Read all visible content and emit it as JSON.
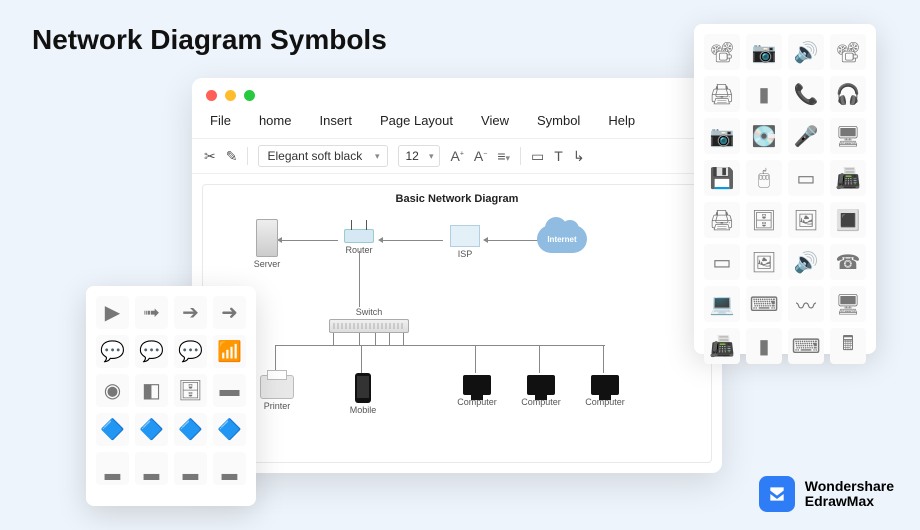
{
  "page_title": "Network Diagram Symbols",
  "app": {
    "menu": [
      "File",
      "home",
      "Insert",
      "Page Layout",
      "View",
      "Symbol",
      "Help"
    ],
    "toolbar": {
      "cut_icon": "scissors-icon",
      "brush_icon": "format-brush-icon",
      "font_name": "Elegant soft black",
      "font_size": "12",
      "inc_font": "A⁺",
      "dec_font": "A⁻",
      "align_icon": "align-left-icon",
      "shape_icon": "rectangle-icon",
      "text_icon": "T",
      "connector_icon": "connector-icon"
    }
  },
  "canvas": {
    "title": "Basic Network Diagram",
    "nodes": {
      "server": "Server",
      "router": "Router",
      "isp": "ISP",
      "internet": "Internet",
      "switch": "Switch",
      "printer": "Printer",
      "mobile": "Mobile",
      "computer": "Computer"
    }
  },
  "panels": {
    "left_icons": [
      "arrow-play",
      "arrow-dashed",
      "arrow-block",
      "arrow-bold",
      "bubble-green",
      "bubble-blue",
      "bubble-dark",
      "antenna",
      "disc",
      "pillow",
      "server-rack",
      "switch-flat",
      "router-blue-1",
      "router-blue-2",
      "router-blue-3",
      "router-blue-4",
      "bar-green",
      "bar-gray",
      "bar-orange",
      "bar-dark"
    ],
    "right_icons": [
      "projector",
      "webcam",
      "speaker",
      "projector-2",
      "printer",
      "tablet",
      "phone",
      "headphones",
      "camera",
      "hdd",
      "mic",
      "monitor",
      "drive",
      "mouse",
      "scanner-flat",
      "scanner",
      "copier",
      "tower",
      "easel",
      "chip",
      "flatbed",
      "board",
      "speakers",
      "desk-phone",
      "laptop",
      "keyboard",
      "cable",
      "pc-tower",
      "fax",
      "remote",
      "keyboard-2",
      "calculator"
    ]
  },
  "brand": {
    "company": "Wondershare",
    "product": "EdrawMax"
  }
}
